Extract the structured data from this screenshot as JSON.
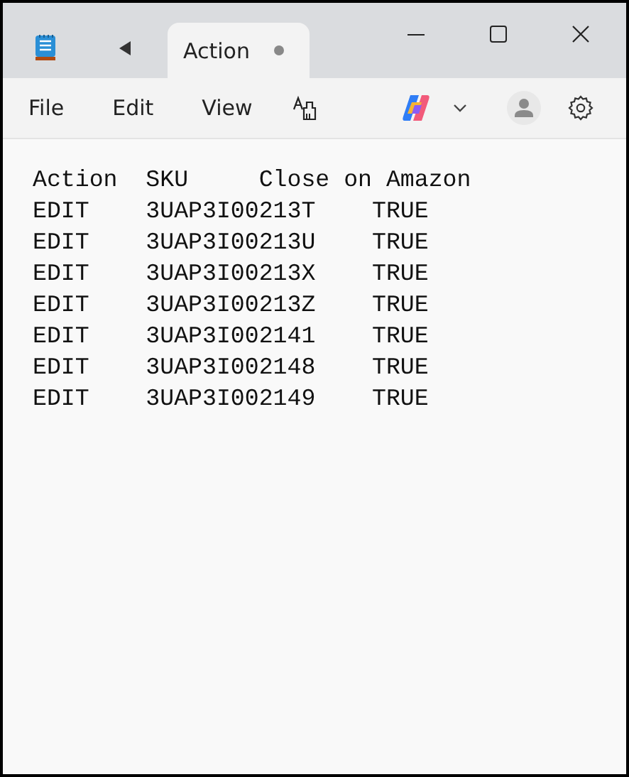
{
  "tab": {
    "label": "Action",
    "modified": true
  },
  "menu": [
    "File",
    "Edit",
    "View"
  ],
  "lines": [
    "Action\tSKU\tClose on Amazon",
    "EDIT\t3UAP3I00213T\tTRUE",
    "EDIT\t3UAP3I00213U\tTRUE",
    "EDIT\t3UAP3I00213X\tTRUE",
    "EDIT\t3UAP3I00213Z\tTRUE",
    "EDIT\t3UAP3I002141\tTRUE",
    "EDIT\t3UAP3I002148\tTRUE",
    "EDIT\t3UAP3I002149\tTRUE"
  ]
}
